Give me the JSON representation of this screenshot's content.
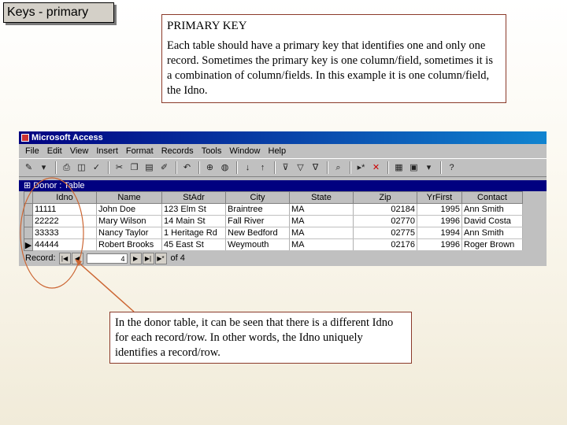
{
  "slide": {
    "title": "Keys - primary",
    "top_box": {
      "heading": "PRIMARY KEY",
      "body": "Each table should have a primary key that identifies one and only one record. Sometimes the primary key is one column/field, sometimes it is a combination of column/fields. In this example it is one column/field, the Idno."
    },
    "bottom_box": {
      "body": "In the donor table, it can be seen that there is a different Idno for each record/row. In other words, the Idno uniquely identifies a record/row."
    }
  },
  "access": {
    "window_title": "Microsoft Access",
    "menu": [
      "File",
      "Edit",
      "View",
      "Insert",
      "Format",
      "Records",
      "Tools",
      "Window",
      "Help"
    ],
    "toolbar_icons": [
      "design-view-icon",
      "print-icon",
      "print-preview-icon",
      "spelling-icon",
      "cut-icon",
      "copy-icon",
      "paste-icon",
      "format-painter-icon",
      "undo-icon",
      "insert-hyperlink-icon",
      "web-toolbar-icon",
      "sort-ascending-icon",
      "sort-descending-icon",
      "filter-by-selection-icon",
      "filter-by-form-icon",
      "apply-filter-icon",
      "find-icon",
      "new-record-icon",
      "delete-record-icon",
      "properties-icon",
      "database-window-icon",
      "new-object-icon",
      "help-icon"
    ],
    "datasheet_title": "Donor : Table",
    "columns": [
      "Idno",
      "Name",
      "StAdr",
      "City",
      "State",
      "Zip",
      "YrFirst",
      "Contact"
    ],
    "rows": [
      [
        "11111",
        "John Doe",
        "123 Elm St",
        "Braintree",
        "MA",
        "02184",
        "1995",
        "Ann Smith"
      ],
      [
        "22222",
        "Mary Wilson",
        "14 Main St",
        "Fall River",
        "MA",
        "02770",
        "1996",
        "David Costa"
      ],
      [
        "33333",
        "Nancy Taylor",
        "1 Heritage Rd",
        "New Bedford",
        "MA",
        "02775",
        "1994",
        "Ann Smith"
      ],
      [
        "44444",
        "Robert Brooks",
        "45 East St",
        "Weymouth",
        "MA",
        "02176",
        "1996",
        "Roger Brown"
      ]
    ],
    "navigator": {
      "label": "Record:",
      "current": "4",
      "of_text": "of 4"
    }
  },
  "annotation": {
    "color": "#cc6633"
  }
}
